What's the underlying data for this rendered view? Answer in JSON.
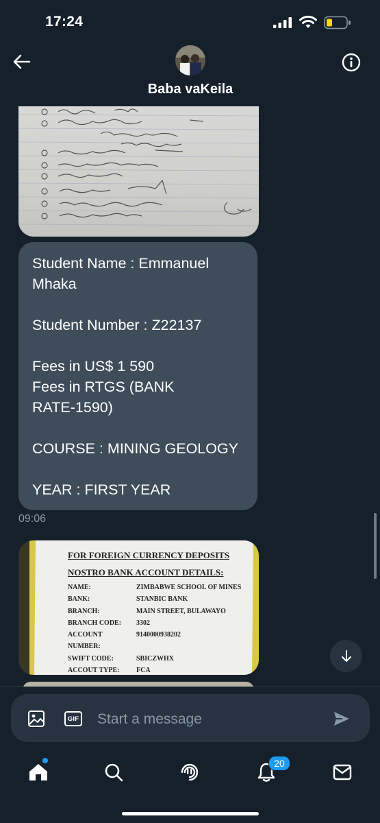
{
  "status_bar": {
    "time": "17:24"
  },
  "header": {
    "contact_name": "Baba vaKeila"
  },
  "messages": {
    "text_lines": [
      "Student Name : Emmanuel",
      "Mhaka",
      "",
      "Student Number : Z22137",
      "",
      "Fees in US$ 1 590",
      "Fees in RTGS (BANK",
      "RATE-1590)",
      "",
      "COURSE : MINING GEOLOGY",
      "",
      "YEAR : FIRST YEAR"
    ],
    "timestamp": "09:06",
    "bank_image": {
      "title1": "FOR FOREIGN CURRENCY DEPOSITS",
      "title2": "NOSTRO BANK ACCOUNT DETAILS:",
      "rows": [
        {
          "label": "NAME:",
          "value": "ZIMBABWE SCHOOL OF MINES"
        },
        {
          "label": "BANK:",
          "value": "STANBIC BANK"
        },
        {
          "label": "BRANCH:",
          "value": "MAIN STREET, BULAWAYO"
        },
        {
          "label": "BRANCH CODE:",
          "value": "3302"
        },
        {
          "label": "ACCOUNT NUMBER:",
          "value": "9140000938202"
        },
        {
          "label": "SWIFT CODE:",
          "value": "SBICZWHX"
        },
        {
          "label": "ACCOUT TYPE:",
          "value": "FCA"
        }
      ]
    }
  },
  "composer": {
    "placeholder": "Start a message",
    "gif_label": "GIF"
  },
  "nav": {
    "notifications_count": "20"
  },
  "colors": {
    "background": "#15202b",
    "bubble": "#3f4d5b",
    "accent": "#1d9bf0",
    "muted": "#8b98a5"
  }
}
